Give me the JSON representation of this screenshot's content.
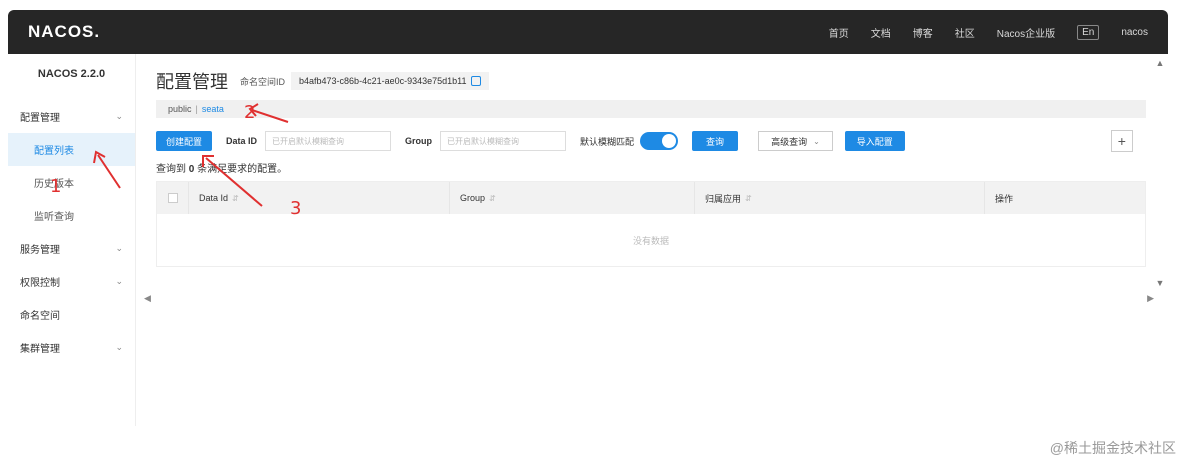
{
  "topbar": {
    "logo": "NACOS.",
    "nav": [
      "首页",
      "文档",
      "博客",
      "社区",
      "Nacos企业版",
      "En",
      "nacos"
    ]
  },
  "sidebar": {
    "version": "NACOS 2.2.0",
    "items": [
      {
        "label": "配置管理",
        "chevron": "⌄"
      },
      {
        "label": "配置列表"
      },
      {
        "label": "历史版本"
      },
      {
        "label": "监听查询"
      },
      {
        "label": "服务管理",
        "chevron": "⌄"
      },
      {
        "label": "权限控制",
        "chevron": "⌄"
      },
      {
        "label": "命名空间"
      },
      {
        "label": "集群管理",
        "chevron": "⌄"
      }
    ]
  },
  "main": {
    "title": "配置管理",
    "namespace_label": "命名空间ID",
    "namespace_id": "b4afb473-c86b-4c21-ae0c-9343e75d1b11",
    "breadcrumb": {
      "first": "public",
      "sep": "|",
      "current": "seata"
    },
    "search": {
      "create_button": "创建配置",
      "data_id_label": "Data ID",
      "data_id_placeholder": "已开启默认模糊查询",
      "group_label": "Group",
      "group_placeholder": "已开启默认模糊查询",
      "fuzzy_label": "默认模糊匹配",
      "query_button": "查询",
      "advanced_button": "高级查询",
      "import_button": "导入配置",
      "plus": "+"
    },
    "result": {
      "prefix": "查询到",
      "count": "0",
      "suffix": "条满足要求的配置。"
    },
    "table": {
      "columns": [
        "Data Id",
        "Group",
        "归属应用",
        "操作"
      ],
      "empty": "没有数据"
    }
  },
  "annotations": [
    "1",
    "2",
    "3"
  ],
  "watermark": "@稀土掘金技术社区",
  "colors": {
    "accent": "#1e8ae4",
    "topbar": "#262626",
    "annotation": "#e03030"
  }
}
